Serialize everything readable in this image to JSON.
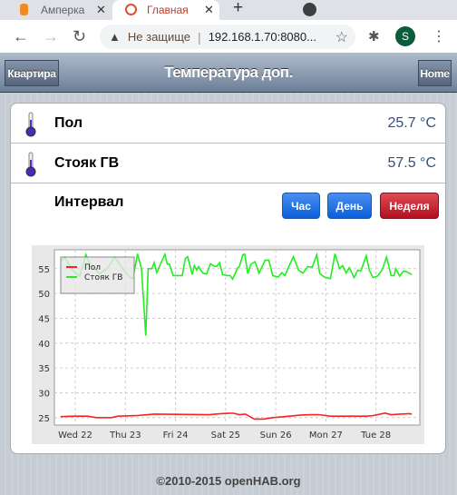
{
  "browser": {
    "tabs": [
      {
        "label": "Амперка"
      },
      {
        "label": "Главная"
      }
    ],
    "security": "Не защище",
    "url": "192.168.1.70:8080...",
    "profile_initial": "S"
  },
  "header": {
    "back_label": "Квартира",
    "title": "Температура доп.",
    "home_label": "Home"
  },
  "items": [
    {
      "label": "Пол",
      "value": "25.7 °C",
      "icon": "thermometer-icon"
    },
    {
      "label": "Стояк ГВ",
      "value": "57.5 °C",
      "icon": "thermometer-icon"
    }
  ],
  "interval": {
    "label": "Интервал",
    "buttons": [
      {
        "label": "Час",
        "color": "#1a6be0"
      },
      {
        "label": "День",
        "color": "#1a6be0"
      },
      {
        "label": "Неделя",
        "color": "#c8202d"
      }
    ]
  },
  "chart_data": {
    "type": "line",
    "grid": true,
    "legend": "top-left",
    "ylim": [
      23.5,
      58.8
    ],
    "yticks": [
      25,
      30,
      35,
      40,
      45,
      50,
      55
    ],
    "xticks": [
      {
        "t": "22 00:00",
        "label": "Wed 22"
      },
      {
        "t": "23 00:00",
        "label": "Thu 23"
      },
      {
        "t": "24 00:00",
        "label": "Fri 24"
      },
      {
        "t": "25 00:00",
        "label": "Sat 25"
      },
      {
        "t": "26 00:00",
        "label": "Sun 26"
      },
      {
        "t": "27 00:00",
        "label": "Mon 27"
      },
      {
        "t": "28 00:00",
        "label": "Tue 28"
      }
    ],
    "xlim": [
      "21 14:00",
      "28 21:00"
    ],
    "series": [
      {
        "name": "Пол",
        "color": "#ff2020",
        "points": [
          [
            "21 17:00",
            25.2
          ],
          [
            "22 00:00",
            25.3
          ],
          [
            "22 05:49",
            25.3
          ],
          [
            "22 10:11",
            25.0
          ],
          [
            "22 17:27",
            25.0
          ],
          [
            "22 20:22",
            25.3
          ],
          [
            "23 05:05",
            25.4
          ],
          [
            "23 08:00",
            25.5
          ],
          [
            "23 13:49",
            25.7
          ],
          [
            "24 16:00",
            25.6
          ],
          [
            "24 21:49",
            25.8
          ],
          [
            "25 03:38",
            25.9
          ],
          [
            "25 06:33",
            25.6
          ],
          [
            "25 09:27",
            25.7
          ],
          [
            "25 13:49",
            24.7
          ],
          [
            "25 18:11",
            24.7
          ],
          [
            "25 22:33",
            25.0
          ],
          [
            "26 04:22",
            25.2
          ],
          [
            "26 11:38",
            25.5
          ],
          [
            "26 16:00",
            25.6
          ],
          [
            "26 20:22",
            25.6
          ],
          [
            "27 02:11",
            25.3
          ],
          [
            "27 09:27",
            25.3
          ],
          [
            "27 19:38",
            25.3
          ],
          [
            "27 22:33",
            25.4
          ],
          [
            "28 04:22",
            25.9
          ],
          [
            "28 07:16",
            25.6
          ],
          [
            "28 11:38",
            25.7
          ],
          [
            "28 16:00",
            25.8
          ],
          [
            "28 17:10",
            25.7
          ]
        ]
      },
      {
        "name": "Стояк ГВ",
        "color": "#22ee22",
        "points": [
          [
            "21 17:00",
            56.5
          ],
          [
            "21 19:00",
            57.3
          ],
          [
            "21 22:30",
            54.7
          ],
          [
            "22 02:10",
            53.5
          ],
          [
            "22 05:05",
            57.8
          ],
          [
            "22 07:16",
            55.6
          ],
          [
            "22 11:38",
            54.0
          ],
          [
            "22 15:16",
            55.0
          ],
          [
            "22 18:55",
            57.3
          ],
          [
            "22 23:16",
            54.7
          ],
          [
            "23 02:11",
            53.2
          ],
          [
            "23 03:38",
            53.0
          ],
          [
            "23 05:49",
            58.0
          ],
          [
            "23 07:43",
            55.0
          ],
          [
            "23 09:45",
            41.5
          ],
          [
            "23 10:55",
            55.0
          ],
          [
            "23 12:39",
            55.0
          ],
          [
            "23 13:49",
            56.2
          ],
          [
            "23 15:00",
            54.2
          ],
          [
            "23 18:55",
            57.9
          ],
          [
            "23 20:04",
            55.9
          ],
          [
            "23 21:05",
            55.9
          ],
          [
            "23 22:50",
            53.6
          ],
          [
            "24 01:27",
            53.6
          ],
          [
            "24 03:12",
            53.6
          ],
          [
            "24 04:39",
            57.0
          ],
          [
            "24 05:49",
            57.4
          ],
          [
            "24 08:00",
            53.8
          ],
          [
            "24 09:01",
            55.6
          ],
          [
            "24 10:11",
            54.7
          ],
          [
            "24 11:03",
            55.4
          ],
          [
            "24 13:05",
            54.1
          ],
          [
            "24 14:50",
            53.9
          ],
          [
            "24 16:44",
            56.0
          ],
          [
            "24 18:11",
            55.6
          ],
          [
            "24 19:38",
            55.4
          ],
          [
            "24 21:05",
            56.2
          ],
          [
            "24 22:33",
            53.8
          ],
          [
            "25 00:44",
            53.6
          ],
          [
            "25 02:11",
            53.6
          ],
          [
            "25 03:21",
            52.9
          ],
          [
            "25 05:49",
            55.2
          ],
          [
            "25 06:33",
            55.4
          ],
          [
            "25 08:17",
            57.8
          ],
          [
            "25 09:10",
            57.9
          ],
          [
            "25 10:37",
            54.0
          ],
          [
            "25 12:04",
            55.9
          ],
          [
            "25 14:06",
            56.4
          ],
          [
            "25 16:00",
            54.1
          ],
          [
            "25 18:55",
            56.7
          ],
          [
            "25 20:40",
            56.7
          ],
          [
            "25 22:33",
            53.6
          ],
          [
            "26 01:10",
            53.3
          ],
          [
            "26 02:55",
            54.2
          ],
          [
            "26 04:22",
            53.6
          ],
          [
            "26 06:07",
            55.3
          ],
          [
            "26 08:26",
            57.4
          ],
          [
            "26 10:55",
            54.7
          ],
          [
            "26 13:05",
            54.1
          ],
          [
            "26 15:16",
            55.4
          ],
          [
            "26 17:27",
            55.3
          ],
          [
            "26 19:38",
            57.8
          ],
          [
            "26 21:05",
            54.0
          ],
          [
            "26 23:16",
            53.3
          ],
          [
            "27 02:11",
            53.0
          ],
          [
            "27 04:22",
            58.0
          ],
          [
            "27 06:33",
            55.0
          ],
          [
            "27 08:00",
            55.6
          ],
          [
            "27 09:45",
            54.1
          ],
          [
            "27 11:12",
            55.2
          ],
          [
            "27 13:31",
            53.2
          ],
          [
            "27 15:16",
            54.7
          ],
          [
            "27 16:44",
            54.5
          ],
          [
            "27 19:21",
            57.6
          ],
          [
            "27 20:48",
            54.7
          ],
          [
            "27 22:33",
            53.2
          ],
          [
            "28 00:44",
            53.5
          ],
          [
            "28 02:55",
            54.7
          ],
          [
            "28 05:05",
            57.3
          ],
          [
            "28 07:16",
            53.6
          ],
          [
            "28 08:43",
            53.6
          ],
          [
            "28 09:27",
            55.0
          ],
          [
            "28 11:21",
            53.5
          ],
          [
            "28 13:05",
            54.5
          ],
          [
            "28 14:33",
            54.4
          ],
          [
            "28 17:10",
            53.8
          ]
        ]
      }
    ]
  },
  "footer": "©2010-2015 openHAB.org"
}
